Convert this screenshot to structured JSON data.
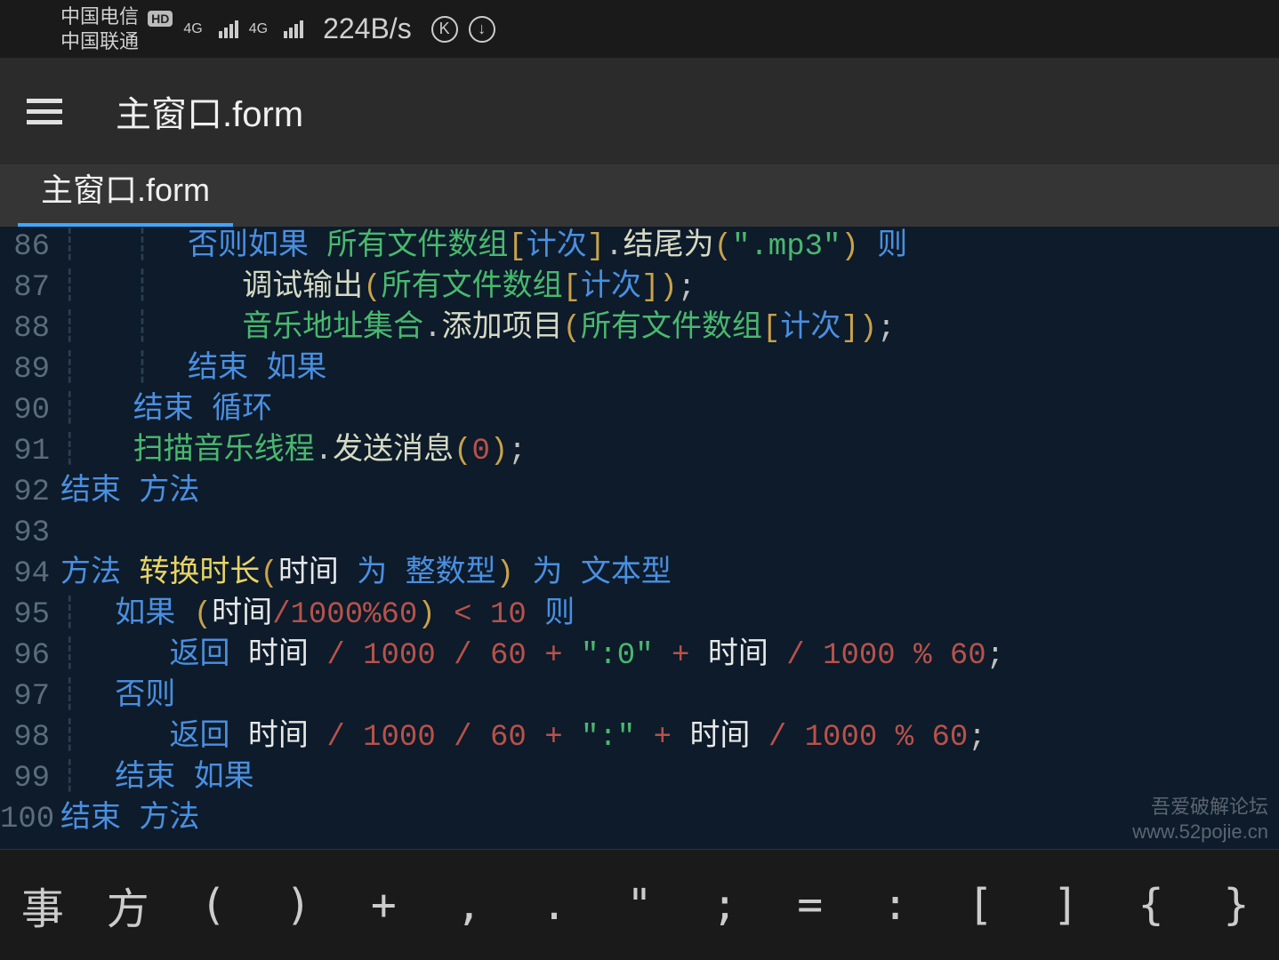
{
  "status": {
    "carrier1": "中国电信",
    "carrier2": "中国联通",
    "hd": "HD",
    "fourg": "4G",
    "speed": "224B/s",
    "icon_k": "K",
    "icon_dl": "↓"
  },
  "app": {
    "title": "主窗口.form"
  },
  "tabs": {
    "active": "主窗口.form"
  },
  "lines": [
    86,
    87,
    88,
    89,
    90,
    91,
    92,
    93,
    94,
    95,
    96,
    97,
    98,
    99,
    100
  ],
  "code": {
    "l86": {
      "kw1": "否则如果",
      "id1": "所有文件数组",
      "idx": "计次",
      "fn": "结尾为",
      "str": "\".mp3\"",
      "kw2": "则"
    },
    "l87": {
      "fn": "调试输出",
      "id1": "所有文件数组",
      "idx": "计次"
    },
    "l88": {
      "id0": "音乐地址集合",
      "fn": "添加项目",
      "id1": "所有文件数组",
      "idx": "计次"
    },
    "l89": {
      "kw1": "结束",
      "kw2": "如果"
    },
    "l90": {
      "kw1": "结束",
      "kw2": "循环"
    },
    "l91": {
      "id": "扫描音乐线程",
      "fn": "发送消息",
      "num": "0"
    },
    "l92": {
      "kw1": "结束",
      "kw2": "方法"
    },
    "l94": {
      "kw1": "方法",
      "name": "转换时长",
      "p": "时间",
      "kw2": "为",
      "type1": "整数型",
      "kw3": "为",
      "type2": "文本型"
    },
    "l95": {
      "kw": "如果",
      "p": "时间",
      "n1": "1000",
      "n2": "60",
      "n3": "10",
      "kw2": "则"
    },
    "l96": {
      "kw": "返回",
      "p": "时间",
      "n1": "1000",
      "n2": "60",
      "str": "\":0\"",
      "p2": "时间",
      "n3": "1000",
      "n4": "60"
    },
    "l97": {
      "kw": "否则"
    },
    "l98": {
      "kw": "返回",
      "p": "时间",
      "n1": "1000",
      "n2": "60",
      "str": "\":\"",
      "p2": "时间",
      "n3": "1000",
      "n4": "60"
    },
    "l99": {
      "kw1": "结束",
      "kw2": "如果"
    },
    "l100": {
      "kw1": "结束",
      "kw2": "方法"
    }
  },
  "symbols": [
    "事",
    "方",
    "(",
    ")",
    "+",
    ",",
    ".",
    "\"",
    ";",
    "=",
    ":",
    "[",
    "]",
    "{",
    "}"
  ],
  "watermark": {
    "l1": "吾爱破解论坛",
    "l2": "www.52pojie.cn"
  }
}
